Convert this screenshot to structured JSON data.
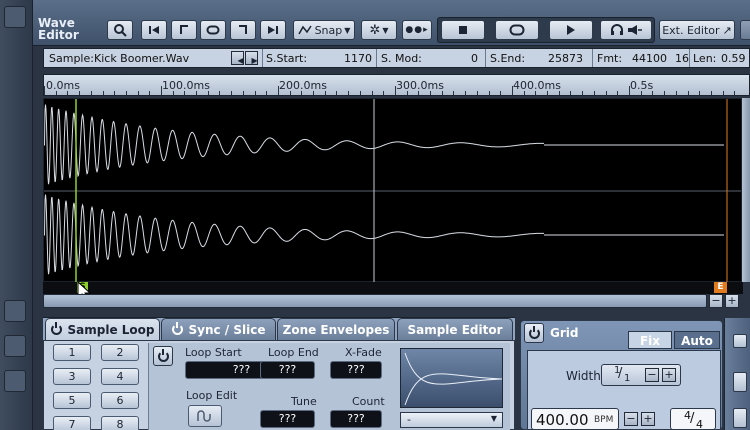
{
  "window": {
    "title": "Wave Editor"
  },
  "toolbar": {
    "snap_label": "Snap",
    "ext_editor_label": "Ext. Editor"
  },
  "info": {
    "sample_label": "Sample:",
    "sample_name": "Kick Boomer.Wav",
    "s_start_label": "S.Start:",
    "s_start_value": "1170",
    "s_mod_label": "S. Mod:",
    "s_mod_value": "0",
    "s_end_label": "S.End:",
    "s_end_value": "25873",
    "fmt_label": "Fmt:",
    "fmt_rate": "44100",
    "fmt_bits": "16",
    "len_label": "Len:",
    "len_value": "0.59"
  },
  "ruler": {
    "ticks": [
      "0.0ms",
      "100.0ms",
      "200.0ms",
      "300.0ms",
      "400.0ms",
      "0.5s"
    ]
  },
  "markers": {
    "start_marker": "S",
    "end_marker": "E"
  },
  "tabs": [
    {
      "label": "Sample Loop",
      "active": true
    },
    {
      "label": "Sync / Slice",
      "active": false
    },
    {
      "label": "Zone Envelopes",
      "active": false
    },
    {
      "label": "Sample Editor",
      "active": false
    }
  ],
  "loop_slots": [
    "1",
    "2",
    "3",
    "4",
    "5",
    "6",
    "7",
    "8"
  ],
  "loop": {
    "loop_start_label": "Loop Start",
    "loop_start_value": "???",
    "loop_end_label": "Loop End",
    "loop_end_value": "???",
    "xfade_label": "X-Fade",
    "xfade_value": "???",
    "loop_edit_label": "Loop Edit",
    "tune_label": "Tune",
    "tune_value": "???",
    "count_label": "Count",
    "count_value": "???",
    "mode_value": "-"
  },
  "grid": {
    "title": "Grid",
    "fix_label": "Fix",
    "auto_label": "Auto",
    "width_label": "Width",
    "width_num": "1",
    "width_den": "1",
    "bpm_value": "400.00",
    "bpm_unit": "BPM",
    "sig_num": "4",
    "sig_den": "4"
  },
  "colors": {
    "waveform": "#d8dde4",
    "cursor": "#8ed12c",
    "end_marker": "#e07b1f",
    "background": "#000000"
  }
}
